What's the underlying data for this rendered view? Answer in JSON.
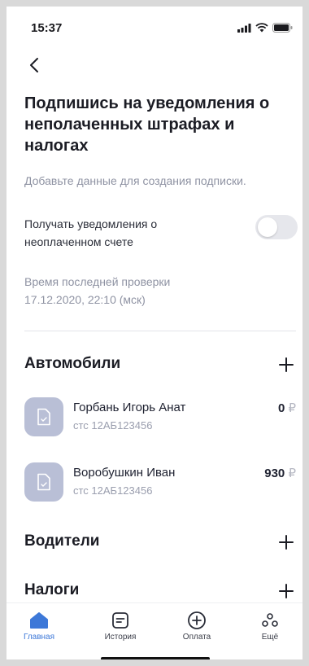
{
  "status_bar": {
    "time": "15:37"
  },
  "header": {
    "title": "Подпишись на уведомления о неполаченных штрафах и налогах",
    "subtitle": "Добавьте данные для создания подписки."
  },
  "notifications": {
    "toggle_label": "Получать уведомления о неоплаченном счете",
    "toggle_on": false,
    "last_check_label": "Время последней проверки",
    "last_check_value": "17.12.2020, 22:10 (мск)"
  },
  "cars": {
    "title": "Автомобили",
    "items": [
      {
        "name": "Горбань Игорь Анат",
        "sts": "стс 12АБ123456",
        "amount": "0",
        "currency": "₽"
      },
      {
        "name": "Воробушкин Иван",
        "sts": "стс 12АБ123456",
        "amount": "930",
        "currency": "₽"
      }
    ]
  },
  "drivers": {
    "title": "Водители"
  },
  "taxes": {
    "title": "Налоги"
  },
  "tab_bar": {
    "items": [
      {
        "label": "Главная",
        "icon": "home-icon",
        "active": true
      },
      {
        "label": "История",
        "icon": "history-icon",
        "active": false
      },
      {
        "label": "Оплата",
        "icon": "add-circle-icon",
        "active": false
      },
      {
        "label": "Ещё",
        "icon": "more-icon",
        "active": false
      }
    ]
  },
  "colors": {
    "accent": "#3d78d8",
    "doc_tile": "#b9bfd6",
    "toggle_off": "#e6e7ec",
    "muted_text": "#8f93a3"
  }
}
